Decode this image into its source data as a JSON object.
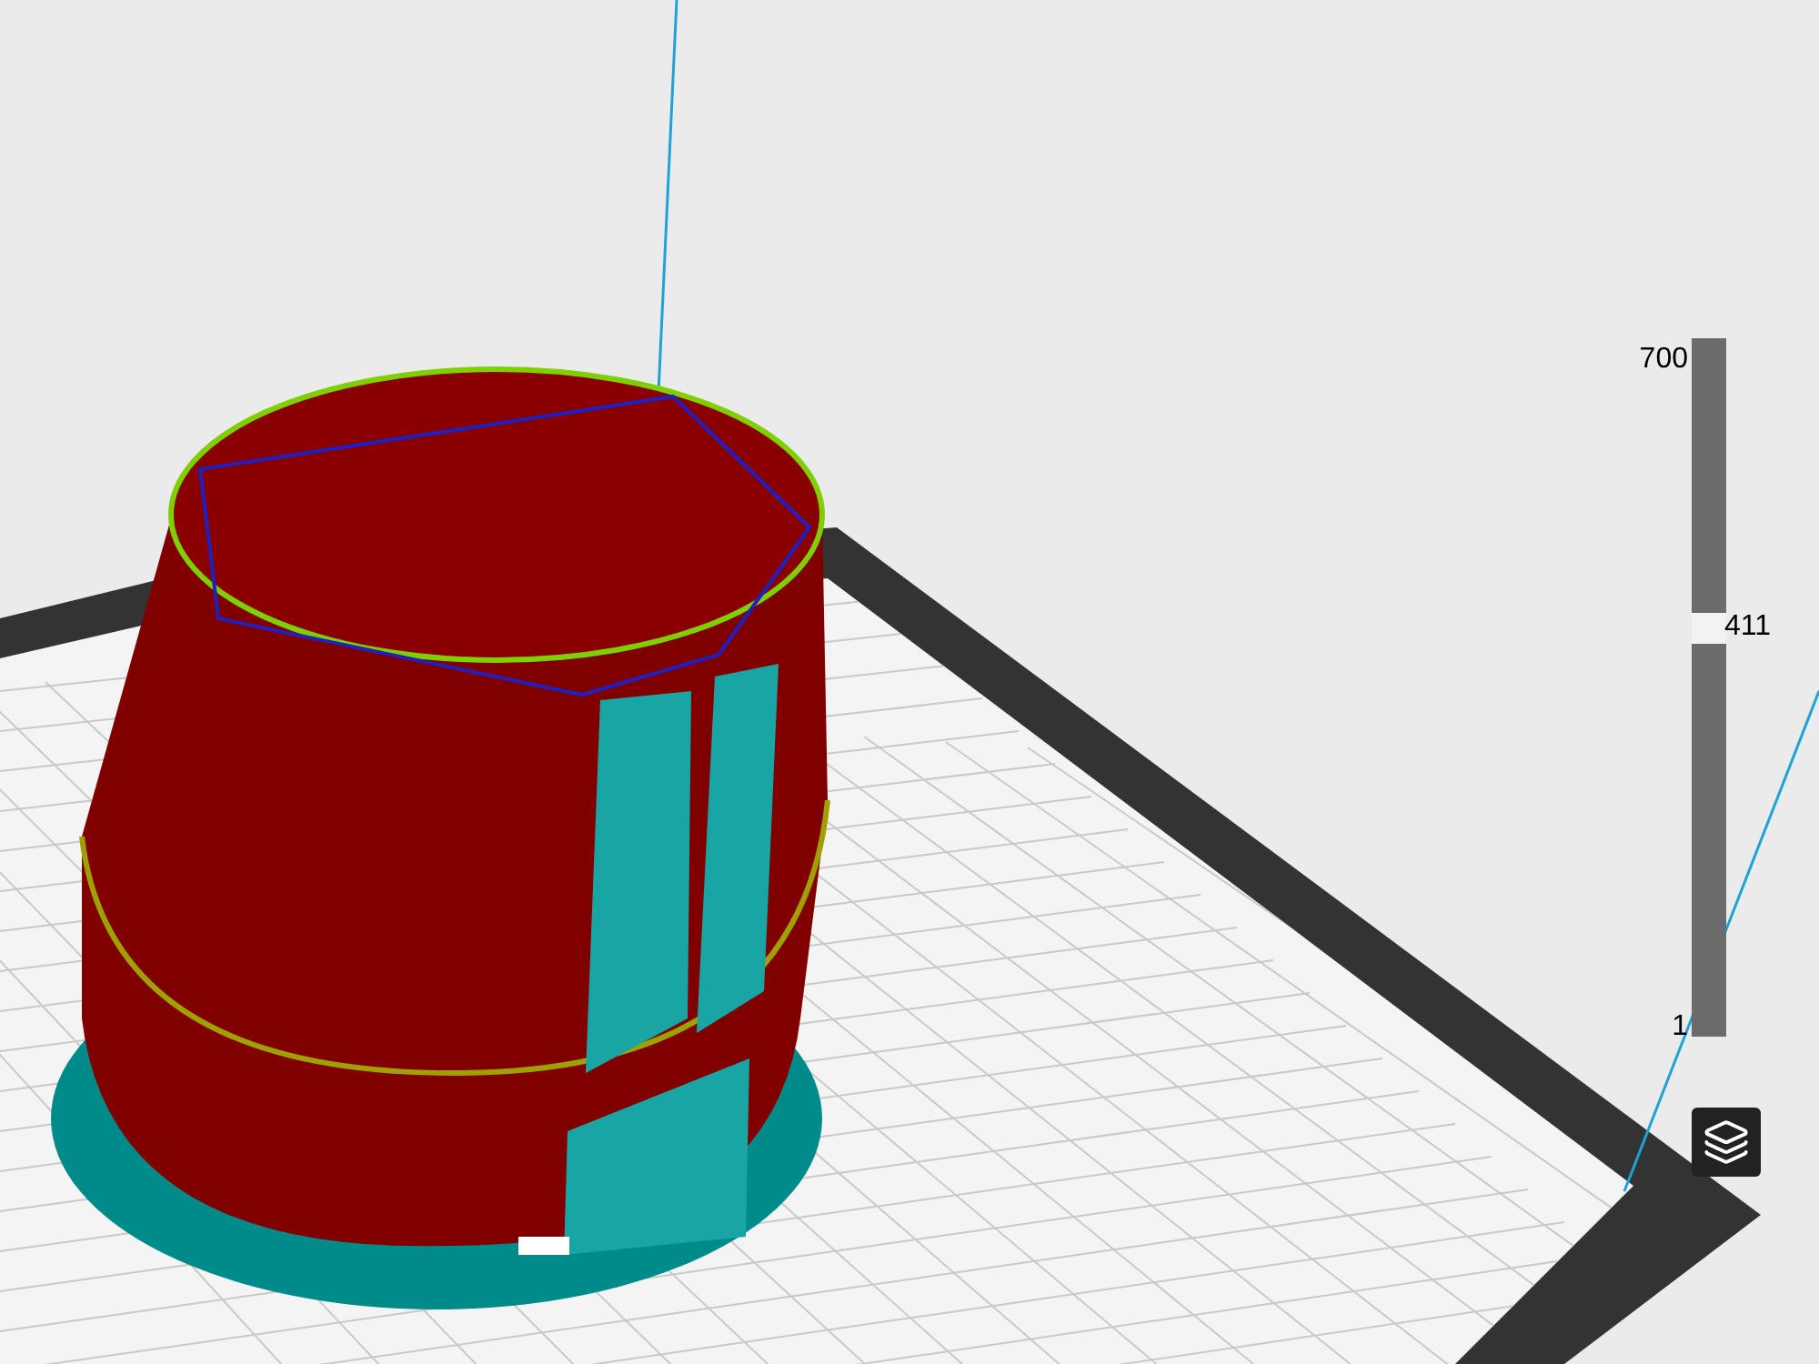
{
  "layer_slider": {
    "max_label": "700",
    "current_label": "411",
    "min_label": "1",
    "level": 0.587
  }
}
